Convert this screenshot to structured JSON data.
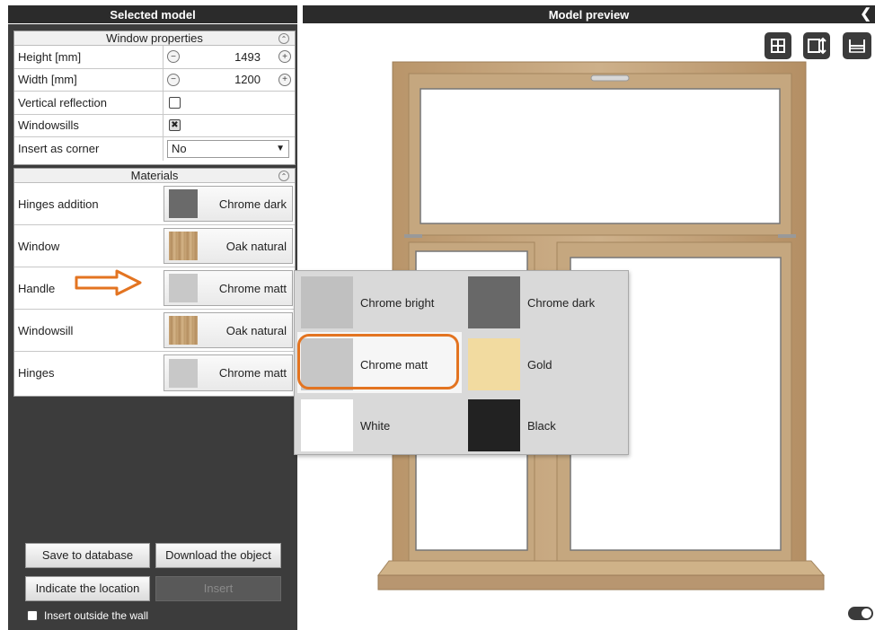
{
  "left_header": "Selected model",
  "right_header": "Model preview",
  "window_properties": {
    "title": "Window properties",
    "height_label": "Height [mm]",
    "height_value": "1493",
    "width_label": "Width [mm]",
    "width_value": "1200",
    "vertical_reflection_label": "Vertical reflection",
    "vertical_reflection_checked": false,
    "windowsills_label": "Windowsills",
    "windowsills_checked": true,
    "insert_corner_label": "Insert as corner",
    "insert_corner_value": "No"
  },
  "materials": {
    "title": "Materials",
    "rows": [
      {
        "label": "Hinges addition",
        "material": "Chrome dark",
        "color": "#6a6a6a"
      },
      {
        "label": "Window",
        "material": "Oak natural",
        "color": "#c4a070"
      },
      {
        "label": "Handle",
        "material": "Chrome matt",
        "color": "#c8c8c8"
      },
      {
        "label": "Windowsill",
        "material": "Oak natural",
        "color": "#c4a070"
      },
      {
        "label": "Hinges",
        "material": "Chrome matt",
        "color": "#c8c8c8"
      }
    ]
  },
  "buttons": {
    "save": "Save to database",
    "download": "Download the object",
    "indicate": "Indicate the location",
    "insert": "Insert"
  },
  "insert_outside_label": "Insert outside the wall",
  "material_popup": {
    "options": [
      {
        "name": "Chrome bright",
        "color": "#c0c0c0"
      },
      {
        "name": "Chrome dark",
        "color": "#686868"
      },
      {
        "name": "Chrome matt",
        "color": "#c6c6c6",
        "selected": true
      },
      {
        "name": "Gold",
        "color": "#f2dba0"
      },
      {
        "name": "White",
        "color": "#ffffff"
      },
      {
        "name": "Black",
        "color": "#222222"
      }
    ]
  },
  "colors": {
    "accent": "#e37421",
    "panel_bg": "#3c3c3c",
    "header_bg": "#2b2b2b"
  },
  "icons": [
    "collapse-left-icon",
    "window-view-icon",
    "resize-view-icon",
    "ruler-icon",
    "arrow-right-icon",
    "toggle-switch"
  ]
}
